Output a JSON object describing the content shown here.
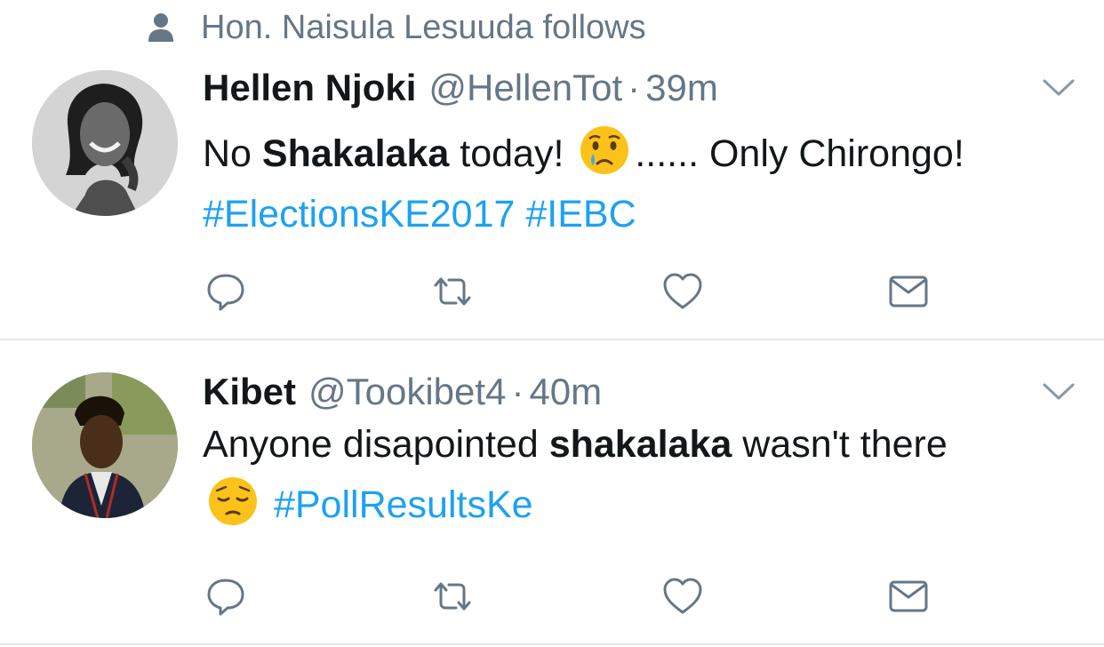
{
  "social_context": {
    "icon": "person-icon",
    "text": "Hon. Naisula Lesuuda follows"
  },
  "tweets": [
    {
      "display_name": "Hellen Njoki",
      "handle": "@HellenTot",
      "separator": "·",
      "time": "39m",
      "text": {
        "t1": "No ",
        "b1": "Shakalaka",
        "t2": " today! ",
        "emoji": "crying-face-emoji",
        "t3": "...... Only Chirongo!",
        "h1": "#ElectionsKE2017",
        "h2": "#IEBC"
      },
      "actions": [
        "reply-icon",
        "retweet-icon",
        "like-icon",
        "direct-message-icon"
      ]
    },
    {
      "display_name": "Kibet",
      "handle": "@Tookibet4",
      "separator": "·",
      "time": "40m",
      "text": {
        "t1": "Anyone disapointed ",
        "b1": "shakalaka",
        "t2": " wasn't there ",
        "emoji": "pensive-face-emoji",
        "h1": "#PollResultsKe"
      },
      "actions": [
        "reply-icon",
        "retweet-icon",
        "like-icon",
        "direct-message-icon"
      ]
    }
  ],
  "colors": {
    "hashtag": "#1da1f2",
    "secondary_text": "#657786",
    "primary_text": "#14171a",
    "divider": "#e1e8ed"
  }
}
